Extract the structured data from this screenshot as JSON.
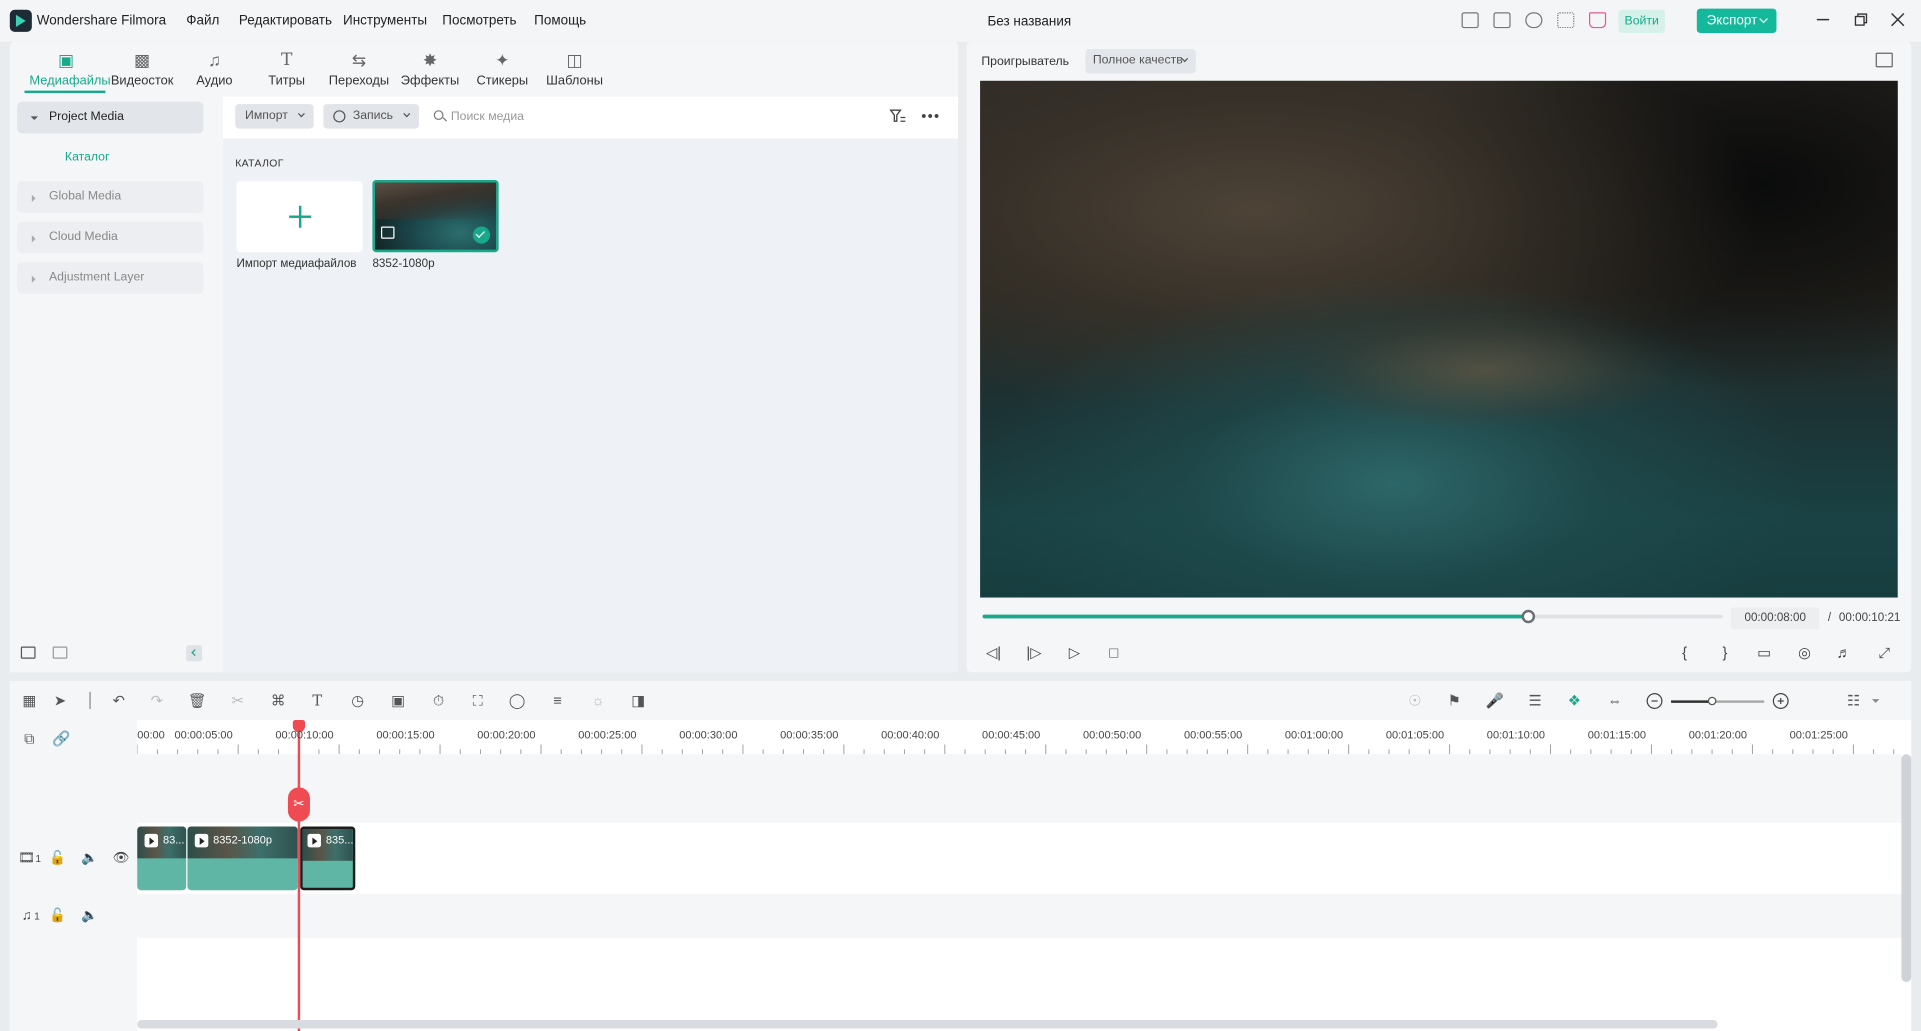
{
  "app": {
    "name": "Wondershare Filmora",
    "document_title": "Без названия",
    "menu": [
      "Файл",
      "Редактировать",
      "Инструменты",
      "Посмотреть",
      "Помощь"
    ],
    "login_label": "Войти",
    "export_label": "Экспорт"
  },
  "media_tabs": [
    {
      "label": "Медиафайлы",
      "icon": "media-icon",
      "active": true
    },
    {
      "label": "Видеосток",
      "icon": "stock-video-icon"
    },
    {
      "label": "Аудио",
      "icon": "music-note-icon"
    },
    {
      "label": "Титры",
      "icon": "text-icon"
    },
    {
      "label": "Переходы",
      "icon": "transition-icon"
    },
    {
      "label": "Эффекты",
      "icon": "effects-icon"
    },
    {
      "label": "Стикеры",
      "icon": "sticker-icon"
    },
    {
      "label": "Шаблоны",
      "icon": "template-icon"
    }
  ],
  "sidebar": {
    "items": [
      {
        "label": "Project Media",
        "expanded": true
      },
      {
        "label": "Global Media"
      },
      {
        "label": "Cloud Media"
      },
      {
        "label": "Adjustment Layer"
      }
    ],
    "sub_item": "Каталог"
  },
  "media_toolbar": {
    "import_label": "Импорт",
    "record_label": "Запись",
    "search_placeholder": "Поиск медиа"
  },
  "catalog": {
    "heading": "КАТАЛОГ",
    "import_caption": "Импорт медиафайлов",
    "clip_caption": "8352-1080p"
  },
  "player": {
    "label": "Проигрыватель",
    "quality": "Полное качеств",
    "time_current": "00:00:08:00",
    "time_separator": "/",
    "time_total": "00:00:10:21",
    "progress": 0.737
  },
  "timeline": {
    "ruler_labels": [
      "00:00",
      "00:00:05:00",
      "00:00:10:00",
      "00:00:15:00",
      "00:00:20:00",
      "00:00:25:00",
      "00:00:30:00",
      "00:00:35:00",
      "00:00:40:00",
      "00:00:45:00",
      "00:00:50:00",
      "00:00:55:00",
      "00:01:00:00",
      "00:01:05:00",
      "00:01:10:00",
      "00:01:15:00",
      "00:01:20:00",
      "00:01:25:00"
    ],
    "clips": [
      {
        "label": "83..."
      },
      {
        "label": "8352-1080p"
      },
      {
        "label": "835..."
      }
    ],
    "video_track_number": "1",
    "audio_track_number": "1",
    "zoom_level": 0.43
  },
  "colors": {
    "accent": "#18a98b",
    "playhead": "#ef4b52"
  }
}
